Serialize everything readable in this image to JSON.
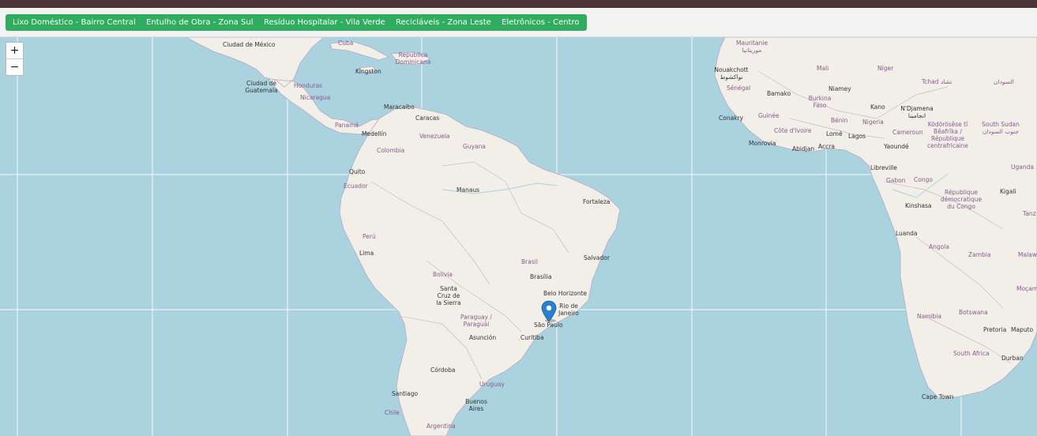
{
  "filters": [
    {
      "label": "Lixo Doméstico - Bairro Central"
    },
    {
      "label": "Entulho de Obra - Zona Sul"
    },
    {
      "label": "Resíduo Hospitalar - Vila Verde"
    },
    {
      "label": "Recicláveis - Zona Leste"
    },
    {
      "label": "Eletrônicos - Centro"
    }
  ],
  "zoom": {
    "in": "+",
    "out": "−"
  },
  "colors": {
    "chip": "#2fac5e",
    "topbar": "#4a3438",
    "sea": "#aad3df",
    "land": "#f2efe9",
    "marker": "#2a81cb"
  },
  "marker": {
    "icon": "map-pin-icon"
  },
  "labels": {
    "ciudad_de_mexico": "Ciudad de México",
    "cuba": "Cuba",
    "rep_dominicana": "República Dominicana",
    "kingston": "Kingston",
    "ciudad_guatemala": "Ciudad de Guatemala",
    "honduras": "Honduras",
    "nicaragua": "Nicaragua",
    "panama": "Panamá",
    "maracaibo": "Maracaibo",
    "caracas": "Caracas",
    "medellin": "Medellín",
    "venezuela": "Venezuela",
    "colombia": "Colombia",
    "guyana": "Guyana",
    "quito": "Quito",
    "ecuador": "Ecuador",
    "manaus": "Manaus",
    "fortaleza": "Fortaleza",
    "peru": "Perú",
    "lima": "Lima",
    "brasil": "Brasil",
    "salvador": "Salvador",
    "brasilia": "Brasília",
    "bolivia": "Bolivia",
    "santa_cruz": "Santa Cruz de la Sierra",
    "belo_horizonte": "Belo Horizonte",
    "rio": "Rio de Janeiro",
    "paraguay": "Paraguay / Paraguái",
    "sao_paulo": "São Paulo",
    "asuncion": "Asunción",
    "curitiba": "Curitiba",
    "cordoba": "Córdoba",
    "uruguay": "Uruguay",
    "santiago": "Santiago",
    "buenos_aires": "Buenos Aires",
    "chile": "Chile",
    "argentina": "Argentina",
    "mauritanie": "Mauritanie موريتانيا",
    "nouakchott": "Nouakchott نواكشوط",
    "mali": "Mali",
    "niger": "Niger",
    "tchad": "Tchad تشاد",
    "soudan": "السودان",
    "senegal": "Sénégal",
    "bamako": "Bamako",
    "burkina": "Burkina Faso",
    "niamey": "Niamey",
    "ndjamena": "N'Djamena انجامينا",
    "kano": "Kano",
    "conakry": "Conakry",
    "guinee": "Guinée",
    "benin": "Bénin",
    "nigeria": "Nigeria",
    "cote_ivoire": "Côte d'Ivoire",
    "lome": "Lomé",
    "cameroun": "Cameroun",
    "kordofan": "Ködörösêse tî Bêafrîka / République centrafricaine",
    "south_sudan": "South Sudan جنوب السودان",
    "monrovia": "Monrovia",
    "abidjan": "Abidjan",
    "accra": "Accra",
    "lagos": "Lagos",
    "yaounde": "Yaoundé",
    "libreville": "Libreville",
    "gabon": "Gabon",
    "congo": "Congo",
    "uganda": "Uganda",
    "kigali": "Kigali",
    "kinshasa": "Kinshasa",
    "rdc": "République démocratique du Congo",
    "tanz": "Tanz",
    "luanda": "Luanda",
    "angola": "Angola",
    "zambia": "Zambia",
    "malawi": "Malaw",
    "mocamb": "Moçam",
    "namibia": "Namibia",
    "botswana": "Botswana",
    "pretoria": "Pretoria",
    "maputo": "Maputo",
    "durban": "Durban",
    "south_africa": "South Africa",
    "cape_town": "Cape Town"
  }
}
